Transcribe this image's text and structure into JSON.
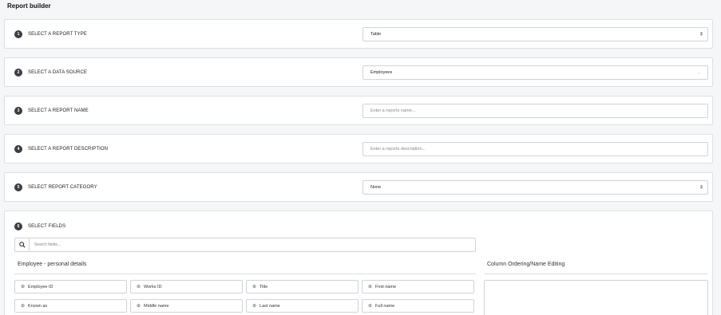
{
  "page_title": "Report builder",
  "steps": [
    {
      "num": "1",
      "label": "SELECT A REPORT TYPE",
      "value": "Table"
    },
    {
      "num": "2",
      "label": "SELECT A DATA SOURCE",
      "value": "Employees"
    },
    {
      "num": "3",
      "label": "SELECT A REPORT NAME",
      "placeholder": "Enter a reports name..."
    },
    {
      "num": "4",
      "label": "SELECT A REPORT DESCRIPTION",
      "placeholder": "Enter a reports description..."
    },
    {
      "num": "5",
      "label": "SELECT REPORT CATEGORY",
      "value": "None"
    },
    {
      "num": "6",
      "label": "SELECT FIELDS"
    }
  ],
  "fields_section": {
    "search_placeholder": "Search fields...",
    "group_title": "Employee - personal details",
    "ordering_title": "Column Ordering/Name Editing",
    "fields": [
      "Employee ID",
      "Works ID",
      "Title",
      "First name",
      "Known as",
      "Middle name",
      "Last name",
      "Full name"
    ]
  },
  "icons": {
    "add": "plus-circle-icon",
    "search": "search-icon",
    "select": "updown-arrow-icon",
    "dropdown": "chevron-down-icon"
  }
}
